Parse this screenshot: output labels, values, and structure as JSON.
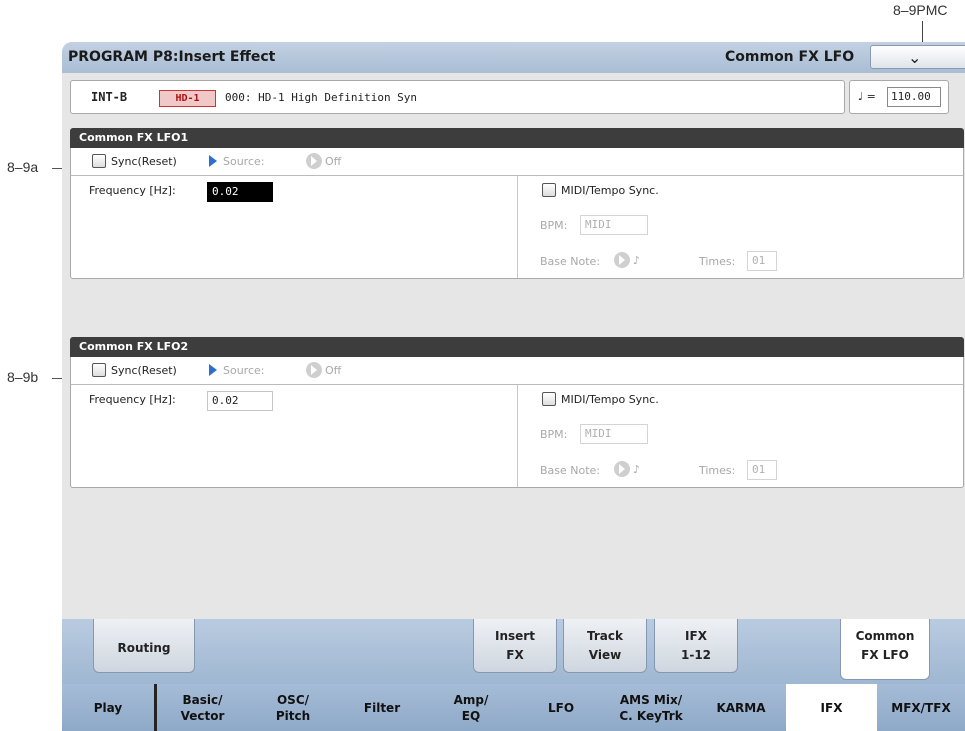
{
  "callouts": {
    "top_right": "8–9PMC",
    "lfo1": "8–9a",
    "lfo2": "8–9b"
  },
  "header": {
    "title": "PROGRAM P8:Insert Effect",
    "page_name": "Common FX LFO"
  },
  "program": {
    "bank": "INT-B",
    "badge": "HD-1",
    "name": "000: HD-1 High Definition Syn",
    "tempo_symbol": "♩ =",
    "tempo": "110.00"
  },
  "lfo1": {
    "title": "Common FX LFO1",
    "sync_label": "Sync(Reset)",
    "source_label": "Source:",
    "source_value": "Off",
    "frequency_label": "Frequency [Hz]:",
    "frequency_value": "0.02",
    "midi_sync_label": "MIDI/Tempo Sync.",
    "bpm_label": "BPM:",
    "bpm_value": "MIDI",
    "base_note_label": "Base Note:",
    "base_note_value": "♪",
    "times_label": "Times:",
    "times_value": "01"
  },
  "lfo2": {
    "title": "Common FX LFO2",
    "sync_label": "Sync(Reset)",
    "source_label": "Source:",
    "source_value": "Off",
    "frequency_label": "Frequency [Hz]:",
    "frequency_value": "0.02",
    "midi_sync_label": "MIDI/Tempo Sync.",
    "bpm_label": "BPM:",
    "bpm_value": "MIDI",
    "base_note_label": "Base Note:",
    "base_note_value": "♪",
    "times_label": "Times:",
    "times_value": "01"
  },
  "subtabs": {
    "routing": "Routing",
    "insert_fx": "Insert\nFX",
    "track_view": "Track\nView",
    "ifx_1_12": "IFX\n1-12",
    "common_fx_lfo": "Common\nFX LFO"
  },
  "maintabs": {
    "play": "Play",
    "basic_vector": "Basic/\nVector",
    "osc_pitch": "OSC/\nPitch",
    "filter": "Filter",
    "amp_eq": "Amp/\nEQ",
    "lfo": "LFO",
    "ams_mix": "AMS Mix/\nC. KeyTrk",
    "karma": "KARMA",
    "ifx": "IFX",
    "mfx_tfx": "MFX/TFX"
  }
}
